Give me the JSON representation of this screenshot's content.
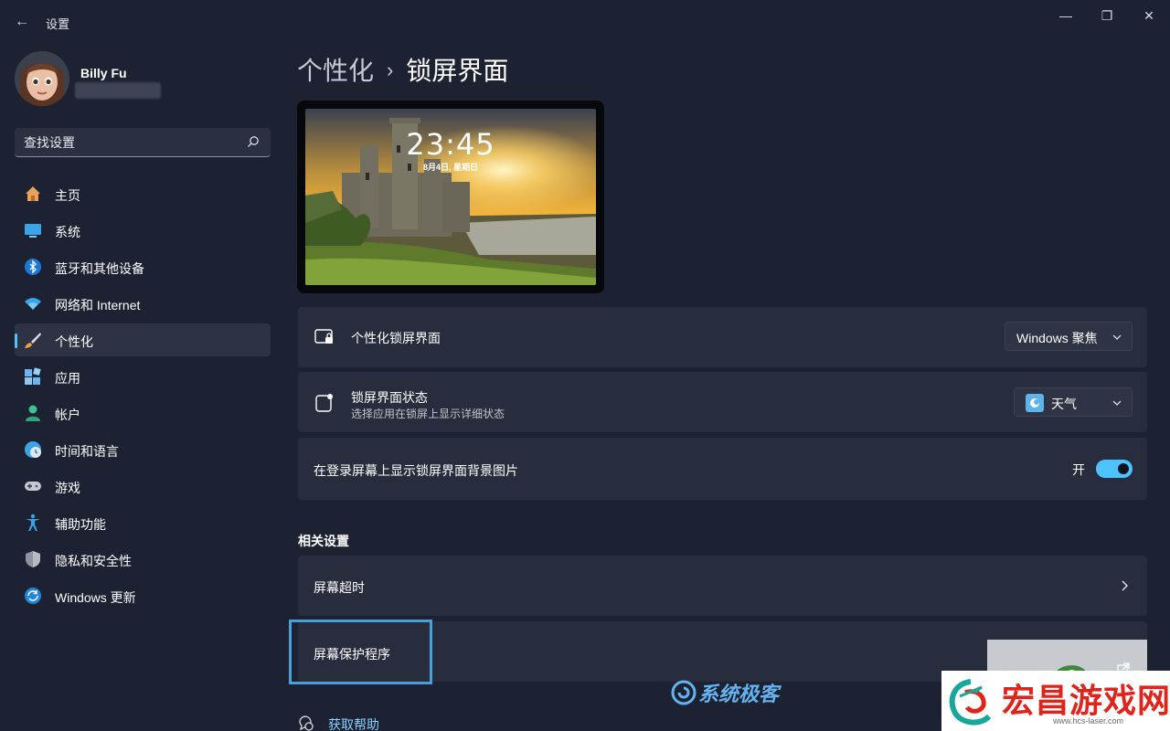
{
  "window": {
    "title": "设置",
    "minimize": "—",
    "maximize": "❐",
    "close": "✕",
    "back": "←"
  },
  "profile": {
    "name": "Billy Fu"
  },
  "search": {
    "placeholder": "查找设置"
  },
  "sidebar": {
    "items": [
      {
        "label": "主页",
        "icon": "home-icon"
      },
      {
        "label": "系统",
        "icon": "system-icon"
      },
      {
        "label": "蓝牙和其他设备",
        "icon": "bluetooth-icon"
      },
      {
        "label": "网络和 Internet",
        "icon": "wifi-icon"
      },
      {
        "label": "个性化",
        "icon": "brush-icon",
        "active": true
      },
      {
        "label": "应用",
        "icon": "apps-icon"
      },
      {
        "label": "帐户",
        "icon": "account-icon"
      },
      {
        "label": "时间和语言",
        "icon": "time-language-icon"
      },
      {
        "label": "游戏",
        "icon": "gamepad-icon"
      },
      {
        "label": "辅助功能",
        "icon": "accessibility-icon"
      },
      {
        "label": "隐私和安全性",
        "icon": "shield-icon"
      },
      {
        "label": "Windows 更新",
        "icon": "update-icon"
      }
    ]
  },
  "breadcrumb": {
    "parent": "个性化",
    "separator": "›",
    "current": "锁屏界面"
  },
  "preview": {
    "time": "23:45",
    "date": "8月4日, 星期日"
  },
  "settings": {
    "personalize": {
      "label": "个性化锁屏界面",
      "value": "Windows 聚焦"
    },
    "status": {
      "label": "锁屏界面状态",
      "description": "选择应用在锁屏上显示详细状态",
      "value": "天气"
    },
    "signin_bg": {
      "label": "在登录屏幕上显示锁屏界面背景图片",
      "state": "开",
      "enabled": true
    }
  },
  "related": {
    "title": "相关设置",
    "items": [
      {
        "label": "屏幕超时"
      },
      {
        "label": "屏幕保护程序"
      }
    ]
  },
  "help": {
    "label": "获取帮助"
  },
  "watermarks": {
    "site1": "系统极客",
    "site2": "宏昌游戏网",
    "site2_url": "www.hcs-laser.com"
  },
  "colors": {
    "accent": "#4cc2ff",
    "background": "#1c2232",
    "card": "#272d3c",
    "link": "#8ad3ff"
  }
}
